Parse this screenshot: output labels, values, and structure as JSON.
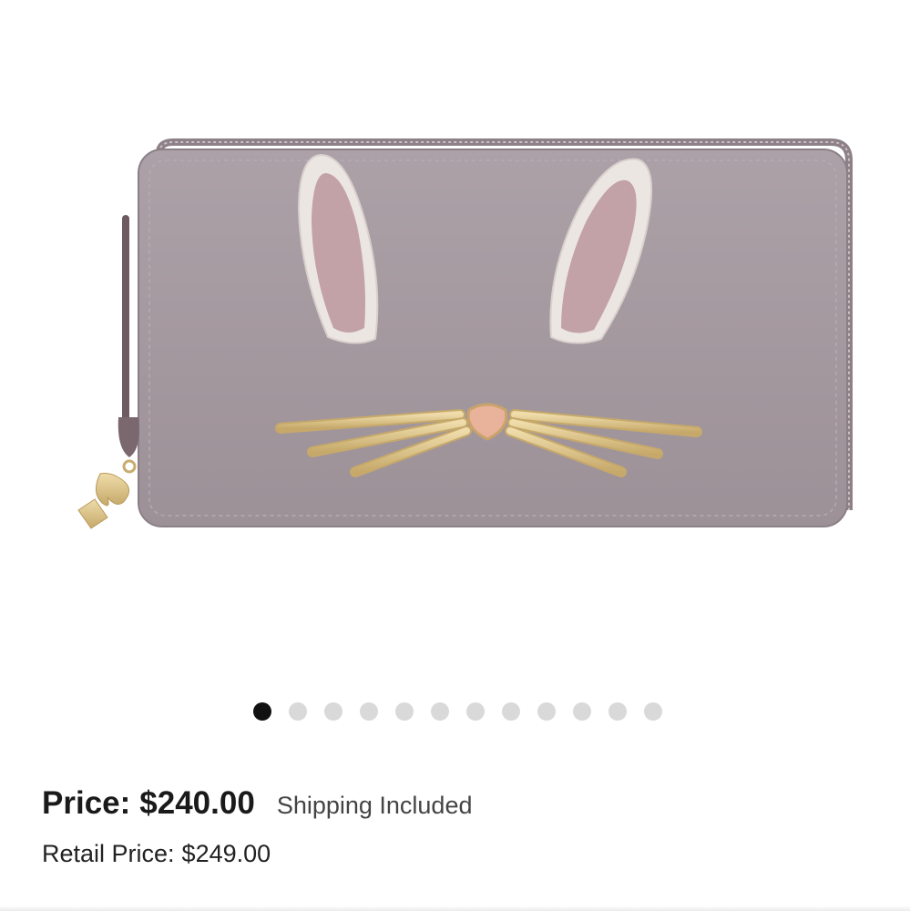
{
  "gallery": {
    "image_alt": "Lilac saffiano leather zip-around wallet with bunny ears and gold whisker appliqué",
    "total_images": 12,
    "active_index": 0,
    "colors": {
      "wallet_body": "#a69aa1",
      "wallet_shade": "#978b92",
      "ear_outer": "#ece6e3",
      "ear_inner": "#c2a1a7",
      "gold": "#d9c08a",
      "nose": "#e9b29a",
      "dot_active": "#111111",
      "dot_inactive": "#d9d9d9"
    }
  },
  "pricing": {
    "price_label": "Price:",
    "price_value": "$240.00",
    "shipping_text": "Shipping Included",
    "retail_label": "Retail Price:",
    "retail_value": "$249.00"
  }
}
